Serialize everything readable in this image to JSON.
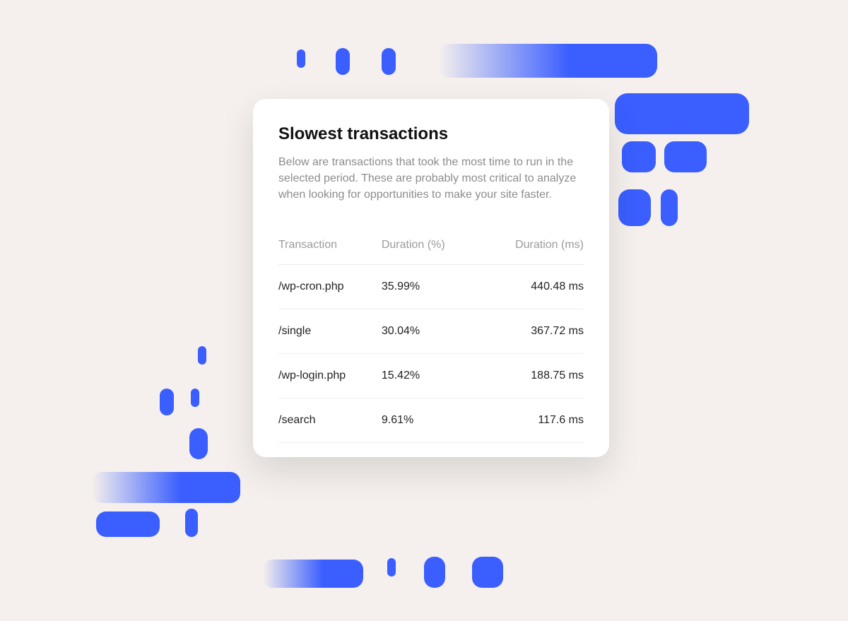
{
  "card": {
    "title": "Slowest transactions",
    "description": "Below are transactions that took the most time to run in the selected period. These are probably most critical to analyze when looking for opportunities to make your site faster."
  },
  "table": {
    "headers": [
      "Transaction",
      "Duration (%)",
      "Duration (ms)"
    ],
    "rows": [
      {
        "transaction": "/wp-cron.php",
        "durationPct": "35.99%",
        "durationMs": "440.48 ms"
      },
      {
        "transaction": "/single",
        "durationPct": "30.04%",
        "durationMs": "367.72 ms"
      },
      {
        "transaction": "/wp-login.php",
        "durationPct": "15.42%",
        "durationMs": "188.75 ms"
      },
      {
        "transaction": "/search",
        "durationPct": "9.61%",
        "durationMs": "117.6 ms"
      }
    ]
  },
  "chart_data": {
    "type": "table",
    "title": "Slowest transactions",
    "columns": [
      "Transaction",
      "Duration (%)",
      "Duration (ms)"
    ],
    "rows": [
      [
        "/wp-cron.php",
        35.99,
        440.48
      ],
      [
        "/single",
        30.04,
        367.72
      ],
      [
        "/wp-login.php",
        15.42,
        188.75
      ],
      [
        "/search",
        9.61,
        117.6
      ]
    ]
  }
}
